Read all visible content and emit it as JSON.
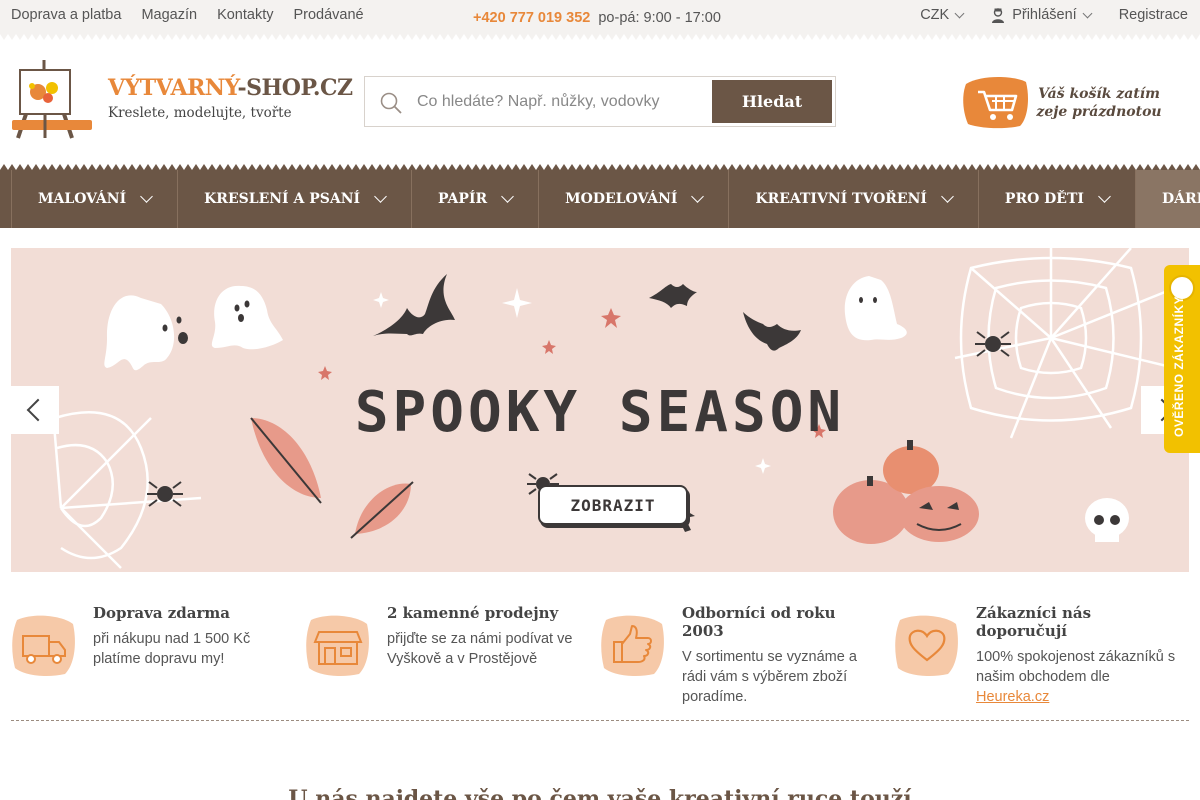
{
  "topbar": {
    "links": [
      "Doprava a platba",
      "Magazín",
      "Kontakty",
      "Prodávané"
    ],
    "phone": "+420 777 019 352",
    "hours": "po-pá: 9:00 - 17:00",
    "currency": "CZK",
    "login": "Přihlášení",
    "register": "Registrace"
  },
  "logo": {
    "title_part1": "VÝTVARNÝ",
    "title_part2": "-SHOP.CZ",
    "tagline": "Kreslete, modelujte, tvořte"
  },
  "search": {
    "placeholder": "Co hledáte? Např. nůžky, vodovky",
    "button": "Hledat"
  },
  "cart": {
    "text": "Váš košík zatím zeje prázdnotou"
  },
  "nav": {
    "items": [
      "MALOVÁNÍ",
      "KRESLENÍ A PSANÍ",
      "PAPÍR",
      "MODELOVÁNÍ",
      "KREATIVNÍ TVOŘENÍ",
      "PRO DĚTI",
      "DÁRKOVÉ POUK"
    ]
  },
  "banner": {
    "title": "SPOOKY SEASON",
    "cta": "ZOBRAZIT"
  },
  "verified": {
    "label": "OVĚŘENO ZÁKAZNÍKY"
  },
  "features": [
    {
      "title": "Doprava zdarma",
      "desc": "při nákupu nad 1 500 Kč platíme dopravu my!",
      "icon": "truck-icon"
    },
    {
      "title": "2 kamenné prodejny",
      "desc": "přijďte se za námi podívat ve Vyškově a v Prostějově",
      "icon": "shop-icon"
    },
    {
      "title": "Odborníci od roku 2003",
      "desc": "V sortimentu se vyznáme a rádi vám s výběrem zboží poradíme.",
      "icon": "thumbs-up-icon"
    },
    {
      "title": "Zákazníci nás doporučují",
      "desc": "100% spokojenost zákazníků s našim obchodem dle",
      "link": "Heureka.cz",
      "icon": "heart-icon"
    }
  ],
  "bottom_heading": "U nás najdete vše po čem vaše kreativní ruce touží",
  "colors": {
    "accent": "#e8883a",
    "brown": "#6b5646",
    "banner_bg": "#f2ddd6",
    "verified": "#f2c100"
  }
}
